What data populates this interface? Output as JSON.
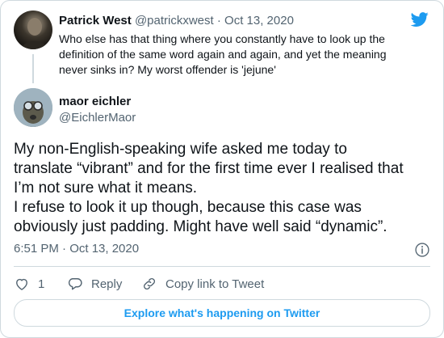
{
  "parent_tweet": {
    "name": "Patrick West",
    "handle": "@patrickxwest",
    "separator": "·",
    "date": "Oct 13, 2020",
    "text_lines": [
      "Who else has that thing where you constantly have to look up the",
      "definition of the same word again and again, and yet the meaning",
      "never sinks in? My worst offender is 'jejune'"
    ]
  },
  "tweet": {
    "author_name": "maor eichler",
    "author_handle": "@EichlerMaor",
    "text_lines": [
      "My non-English-speaking wife asked me today to",
      "translate “vibrant” and for the first time ever I realised that",
      "I’m not sure what it means.",
      "I refuse to look it up though, because this case was",
      "obviously just padding. Might have well said “dynamic”."
    ],
    "timestamp": "6:51 PM · Oct 13, 2020"
  },
  "actions": {
    "like_count": "1",
    "reply_label": "Reply",
    "copy_label": "Copy link to Tweet"
  },
  "explore_label": "Explore what's happening on Twitter",
  "icons": {
    "brand": "twitter-bird-icon",
    "info": "info-icon",
    "like": "heart-icon",
    "reply": "reply-icon",
    "copy": "link-icon"
  },
  "colors": {
    "brand_blue": "#1d9bf0",
    "text": "#0f1419",
    "muted": "#536471",
    "border": "#cfd9de"
  }
}
